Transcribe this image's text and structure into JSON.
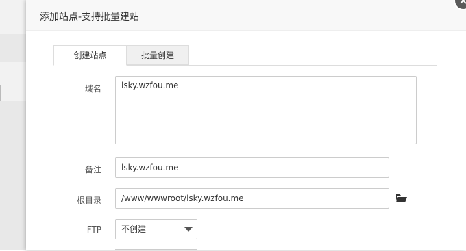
{
  "dialog": {
    "title": "添加站点-支持批量建站",
    "close_symbol": "×"
  },
  "tabs": [
    {
      "label": "创建站点",
      "active": true
    },
    {
      "label": "批量创建",
      "active": false
    }
  ],
  "form": {
    "domain": {
      "label": "域名",
      "value": "lsky.wzfou.me"
    },
    "remark": {
      "label": "备注",
      "value": "lsky.wzfou.me"
    },
    "root_dir": {
      "label": "根目录",
      "value": "/www/wwwroot/lsky.wzfou.me",
      "browse_icon": "folder-open-icon"
    },
    "ftp": {
      "label": "FTP",
      "selected": "不创建"
    }
  },
  "colors": {
    "header_bg": "#f8f8f8",
    "backdrop": "#e8e8e8",
    "close_bg": "#5a5a5a"
  }
}
